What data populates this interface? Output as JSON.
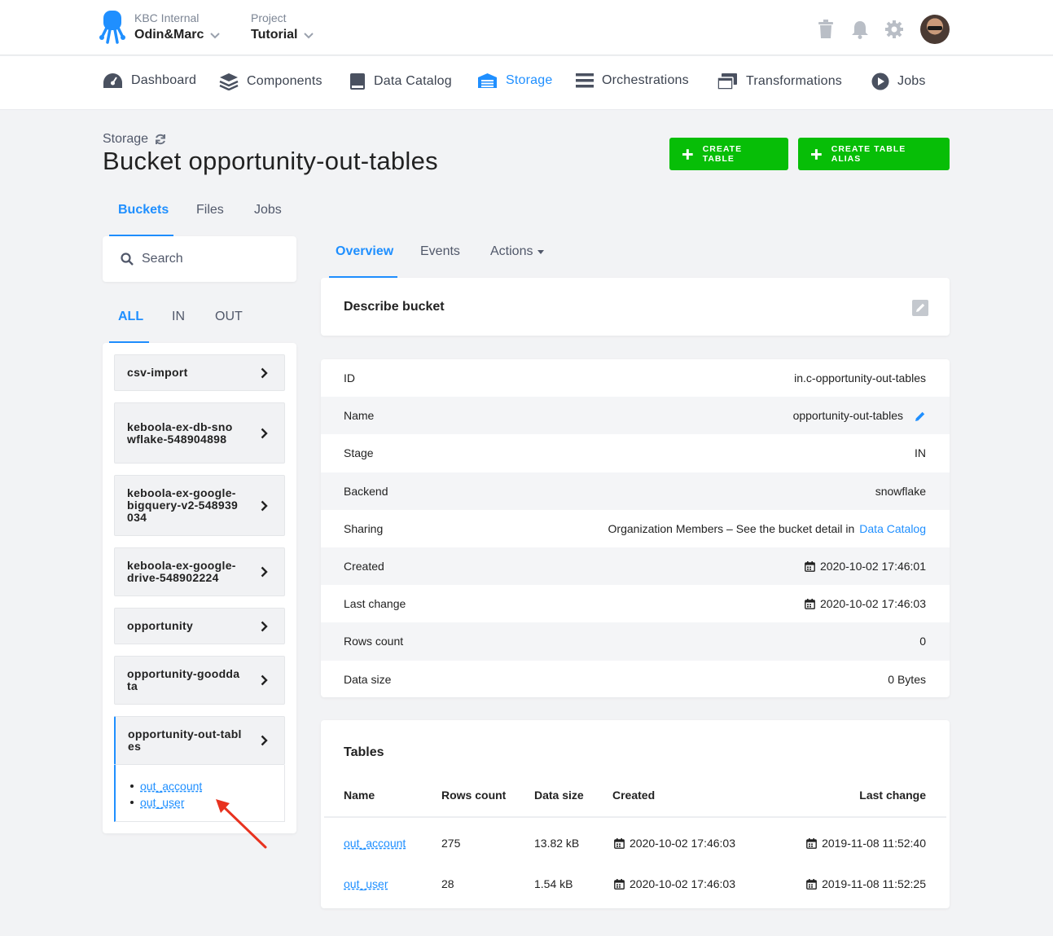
{
  "topbar": {
    "org_label": "KBC Internal",
    "org_name": "Odin&Marc",
    "project_label": "Project",
    "project_name": "Tutorial"
  },
  "nav": {
    "items": [
      {
        "label": "Dashboard",
        "icon": "dashboard-icon"
      },
      {
        "label": "Components",
        "icon": "layers-icon"
      },
      {
        "label": "Data Catalog",
        "icon": "book-icon"
      },
      {
        "label": "Storage",
        "icon": "warehouse-icon",
        "active": true
      },
      {
        "label": "Orchestrations",
        "icon": "bars-icon"
      },
      {
        "label": "Transformations",
        "icon": "windows-icon"
      },
      {
        "label": "Jobs",
        "icon": "play-circle-icon"
      }
    ]
  },
  "header": {
    "breadcrumb": "Storage",
    "title": "Bucket opportunity-out-tables",
    "create_table": "CREATE TABLE",
    "create_alias": "CREATE TABLE ALIAS"
  },
  "tabs": {
    "main": [
      "Buckets",
      "Files",
      "Jobs"
    ],
    "filter": [
      "ALL",
      "IN",
      "OUT"
    ],
    "detail": [
      "Overview",
      "Events",
      "Actions"
    ]
  },
  "search": {
    "placeholder": "Search"
  },
  "buckets": [
    "csv-import",
    "keboola-ex-db-snowflake-548904898",
    "keboola-ex-google-bigquery-v2-548939034",
    "keboola-ex-google-drive-548902224",
    "opportunity",
    "opportunity-gooddata",
    "opportunity-out-tables"
  ],
  "bucket_tables": [
    "out_account",
    "out_user"
  ],
  "describe": {
    "label": "Describe bucket"
  },
  "details": {
    "id": {
      "label": "ID",
      "value": "in.c-opportunity-out-tables"
    },
    "name": {
      "label": "Name",
      "value": "opportunity-out-tables"
    },
    "stage": {
      "label": "Stage",
      "value": "IN"
    },
    "backend": {
      "label": "Backend",
      "value": "snowflake"
    },
    "sharing": {
      "label": "Sharing",
      "value": "Organization Members – See the bucket detail in",
      "link": "Data Catalog"
    },
    "created": {
      "label": "Created",
      "value": "2020-10-02 17:46:01"
    },
    "last_change": {
      "label": "Last change",
      "value": "2020-10-02 17:46:03"
    },
    "rows_count": {
      "label": "Rows count",
      "value": "0"
    },
    "data_size": {
      "label": "Data size",
      "value": "0 Bytes"
    }
  },
  "tables": {
    "title": "Tables",
    "headers": {
      "name": "Name",
      "rows": "Rows count",
      "size": "Data size",
      "created": "Created",
      "last_change": "Last change"
    },
    "rows": [
      {
        "name": "out_account",
        "rows": "275",
        "size": "13.82 kB",
        "created": "2020-10-02 17:46:03",
        "last_change": "2019-11-08 11:52:40"
      },
      {
        "name": "out_user",
        "rows": "28",
        "size": "1.54 kB",
        "created": "2020-10-02 17:46:03",
        "last_change": "2019-11-08 11:52:25"
      }
    ]
  },
  "colors": {
    "accent": "#1f8fff",
    "green": "#07be07",
    "annotation_arrow": "#e8321f"
  }
}
